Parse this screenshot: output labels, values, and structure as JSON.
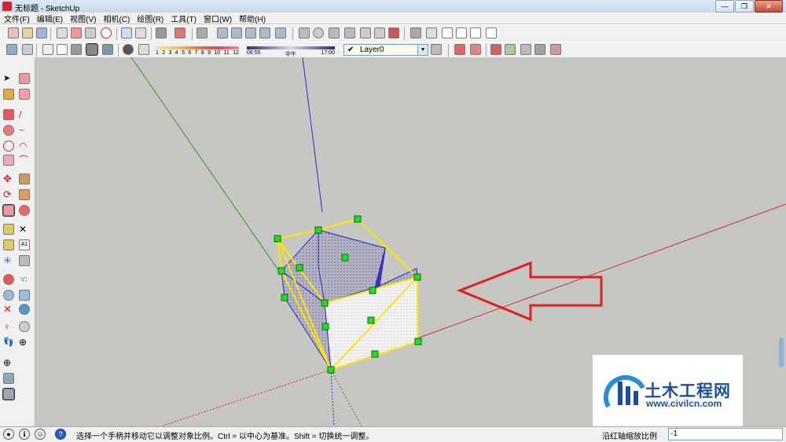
{
  "window": {
    "title": "无标题 - SketchUp",
    "buttons": [
      "—",
      "❐",
      "✕"
    ]
  },
  "menu": [
    "文件(F)",
    "编辑(E)",
    "视图(V)",
    "相机(C)",
    "绘图(R)",
    "工具(T)",
    "窗口(W)",
    "帮助(H)"
  ],
  "toolbar2": {
    "month_labels": [
      "1",
      "2",
      "3",
      "4",
      "5",
      "6",
      "7",
      "8",
      "9",
      "10",
      "11",
      "12"
    ],
    "time_labels": [
      "06:55",
      "中午",
      "17:00"
    ],
    "layer": "Layer0"
  },
  "status": {
    "message": "选择一个手柄并移动它以调整对象比例。Ctrl = 以中心为基准。Shift = 切换统一调整。",
    "value_label": "沿红轴缩放比例",
    "value": "-1"
  },
  "watermark": {
    "name": "土木工程网",
    "url": "www.civilcn.com"
  },
  "colors": {
    "annotation_arrow": "#e02020",
    "selection_box": "#ffe600",
    "handle": "#22dd22",
    "axis_red": "#d03030",
    "axis_green": "#2a9a2a",
    "axis_blue": "#2a2ad0",
    "brand": "#1b4f9c"
  }
}
